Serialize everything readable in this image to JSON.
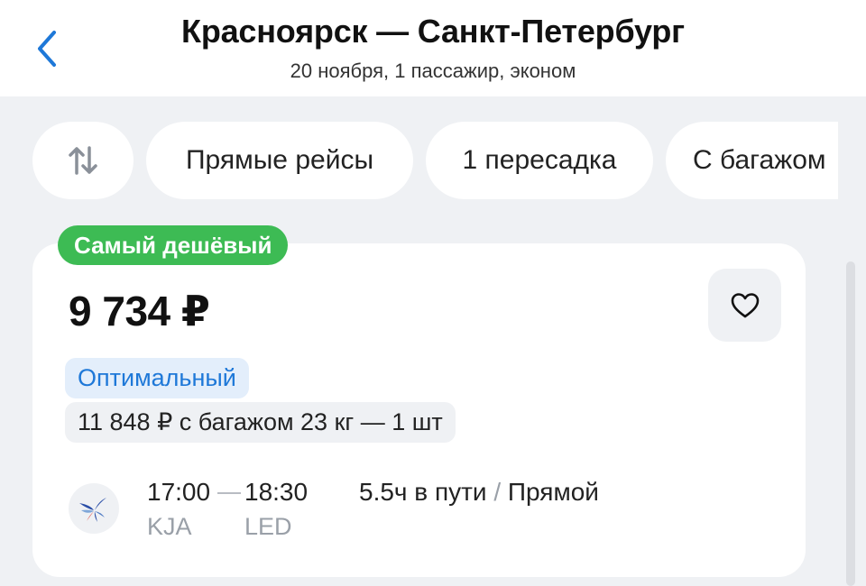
{
  "header": {
    "title": "Красноярск — Санкт-Петербург",
    "subtitle": "20 ноября, 1 пассажир, эконом"
  },
  "filters": {
    "sort_icon": "sort-arrows-icon",
    "chips": [
      "Прямые рейсы",
      "1 пересадка",
      "С багажом"
    ]
  },
  "offer": {
    "badge": "Самый дешёвый",
    "price": "9 734 ₽",
    "tag": "Оптимальный",
    "baggage_info": "11 848 ₽ с багажом 23 кг — 1 шт",
    "airline_icon": "airline-logo-icon",
    "departure_time": "17:00",
    "arrival_time": "18:30",
    "departure_code": "KJA",
    "arrival_code": "LED",
    "duration": "5.5ч в пути",
    "separator": "/",
    "route_type": "Прямой"
  },
  "colors": {
    "accent": "#1e78d8",
    "badge_green": "#3dbb54",
    "background": "#eff1f4"
  }
}
